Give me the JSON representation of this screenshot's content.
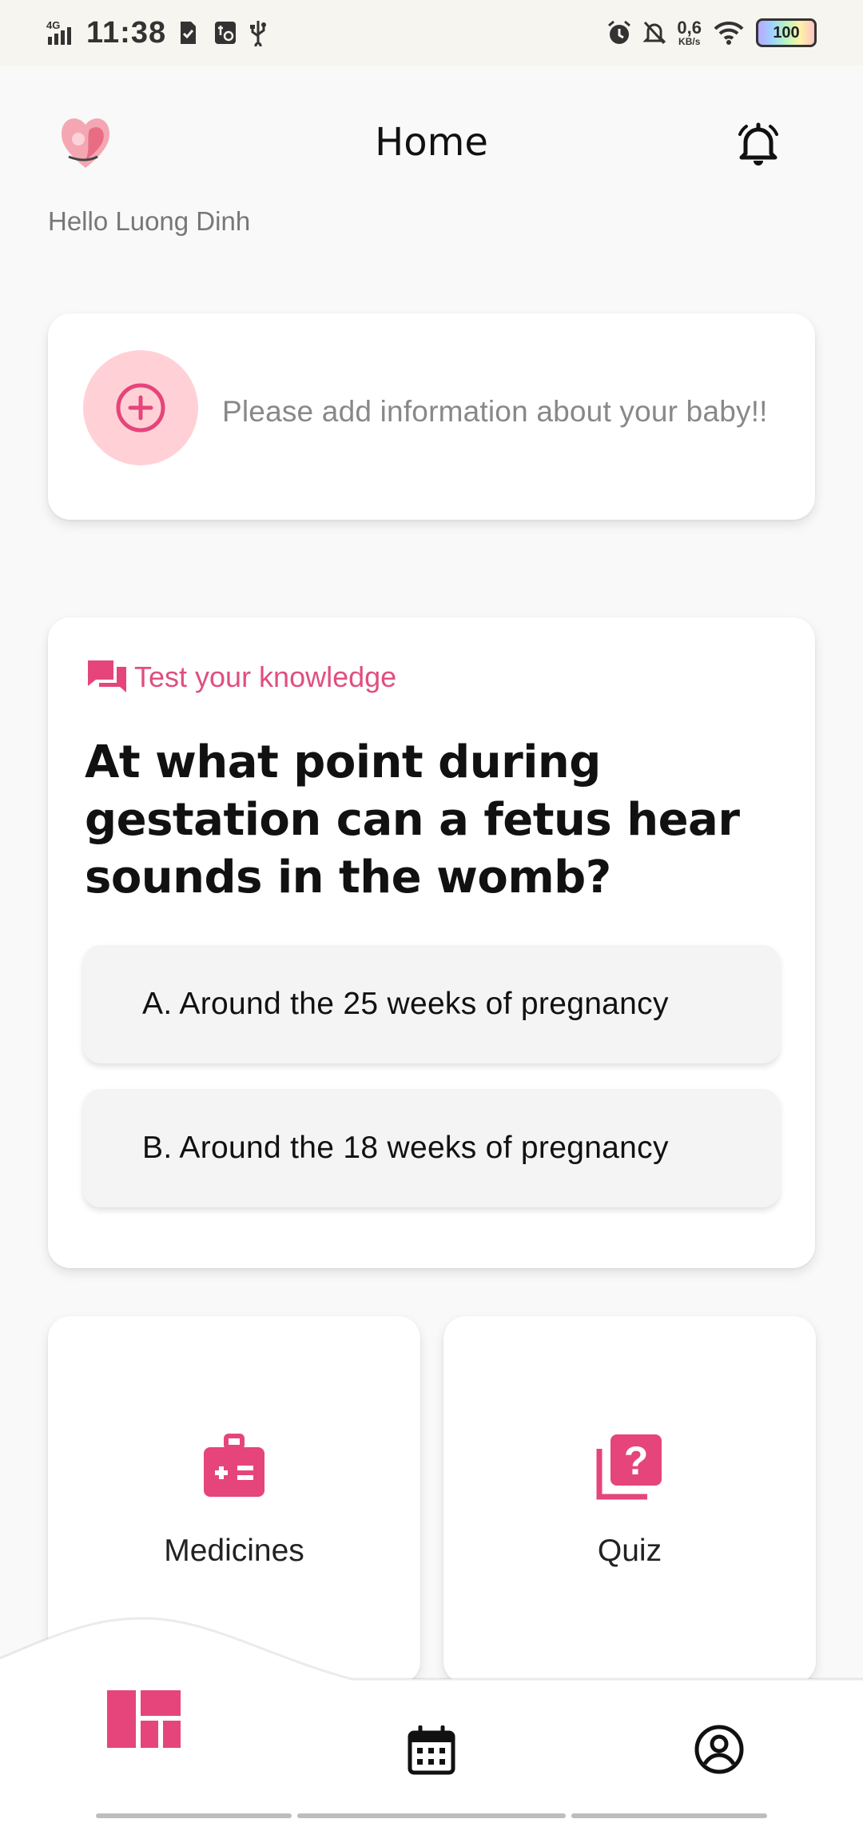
{
  "status_bar": {
    "network": "4G",
    "time": "11:38",
    "speed_value": "0,6",
    "speed_unit": "KB/s",
    "battery": "100",
    "icons": [
      "signal-icon",
      "sim-check-icon",
      "usb-settings-icon",
      "usb-icon",
      "alarm-icon",
      "bell-off-icon",
      "wifi-icon",
      "battery-icon"
    ]
  },
  "header": {
    "title": "Home",
    "greeting": "Hello Luong Dinh",
    "logo_icon": "heart-mother-baby-logo",
    "bell_icon": "bell-icon"
  },
  "baby_card": {
    "prompt": "Please add information about your baby!!",
    "icon": "add-circle-icon"
  },
  "quiz_card": {
    "label": "Test your knowledge",
    "icon": "chat-bubbles-icon",
    "question": "At what point during gestation can a fetus hear sounds in the womb?",
    "options": [
      {
        "label": "A. Around the 25 weeks of pregnancy"
      },
      {
        "label": "B. Around the 18 weeks of pregnancy"
      }
    ]
  },
  "tiles": [
    {
      "label": "Medicines",
      "icon": "medical-kit-icon"
    },
    {
      "label": "Quiz",
      "icon": "quiz-question-icon"
    }
  ],
  "bottom_nav": {
    "items": [
      {
        "name": "dashboard",
        "icon": "dashboard-icon",
        "active": true
      },
      {
        "name": "calendar",
        "icon": "calendar-icon",
        "active": false
      },
      {
        "name": "profile",
        "icon": "profile-icon",
        "active": false
      }
    ]
  },
  "colors": {
    "accent": "#e5457a",
    "accent_light": "#ffd1d7",
    "status_bar_bg": "#f7f5ef"
  }
}
